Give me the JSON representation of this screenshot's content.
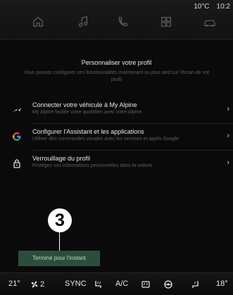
{
  "status": {
    "temperature": "10°C",
    "time": "10:2"
  },
  "nav": [
    "home-icon",
    "music-note-icon",
    "phone-icon",
    "apps-icon",
    "car-icon"
  ],
  "header": {
    "title": "Personnaliser votre profil",
    "subtitle_line1": "Vous pouvez configurer ces fonctionnalités maintenant ou plus tard sur l'écran de vot",
    "subtitle_line2": "profil"
  },
  "items": [
    {
      "title": "Connecter votre véhicule à My Alpine",
      "desc": "My Alpine facilite votre quotidien avec votre Alpine.",
      "icon": "alpine-logo-icon"
    },
    {
      "title": "Configurer l'Assistant et les applications",
      "desc": "Utiliser des commandes vocales avec les services et applis Google",
      "icon": "google-g-icon"
    },
    {
      "title": "Verrouillage du profil",
      "desc": "Protégez vos informations personnelles dans la voiture",
      "icon": "lock-icon"
    }
  ],
  "callout_number": "3",
  "done_button": "Terminé pour l'instant",
  "bottom": {
    "left_temp": "21°",
    "fan_speed": "2",
    "sync": "SYNC",
    "ac": "A/C",
    "right_temp": "18°"
  },
  "colors": {
    "accent_green": "#2b4e3c",
    "accent_green_text": "#b9dcc6",
    "text_primary": "#e9e9e9",
    "text_secondary": "#5f5f5f",
    "background": "#0a0a0a"
  }
}
